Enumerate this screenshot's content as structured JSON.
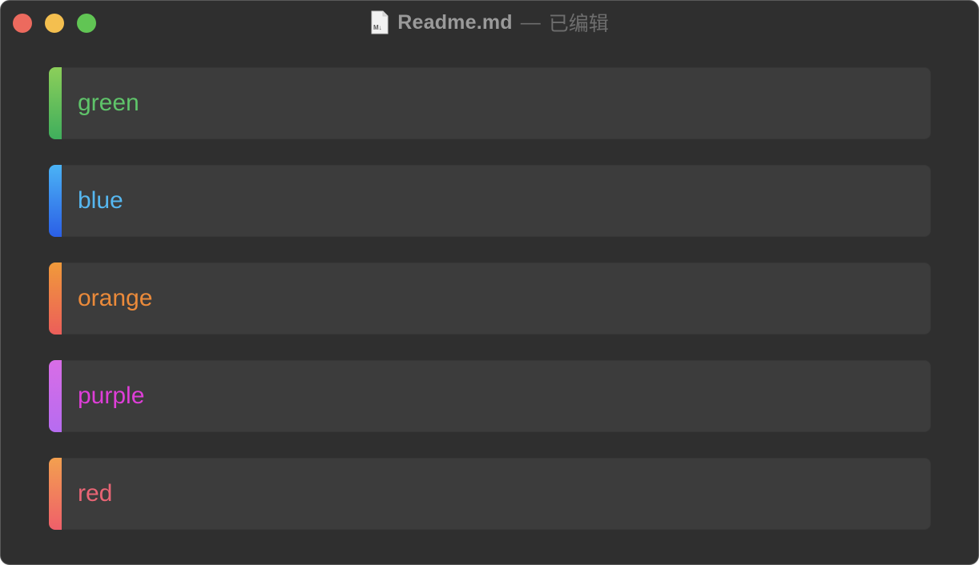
{
  "window": {
    "filename": "Readme.md",
    "separator": "—",
    "status": "已编辑",
    "doc_icon": "markdown-file-icon"
  },
  "callouts": [
    {
      "label": "green",
      "text_color": "#5fc46a",
      "bar_top": "#8ccf5a",
      "bar_bottom": "#3fae5c"
    },
    {
      "label": "blue",
      "text_color": "#56b7f0",
      "bar_top": "#4bb3f5",
      "bar_bottom": "#2b5fe6"
    },
    {
      "label": "orange",
      "text_color": "#eb8a3a",
      "bar_top": "#f09a3a",
      "bar_bottom": "#ec5e5a"
    },
    {
      "label": "purple",
      "text_color": "#de3ed8",
      "bar_top": "#d86de6",
      "bar_bottom": "#b66cf0"
    },
    {
      "label": "red",
      "text_color": "#e96575",
      "bar_top": "#f3a04f",
      "bar_bottom": "#ef5f6a"
    }
  ]
}
